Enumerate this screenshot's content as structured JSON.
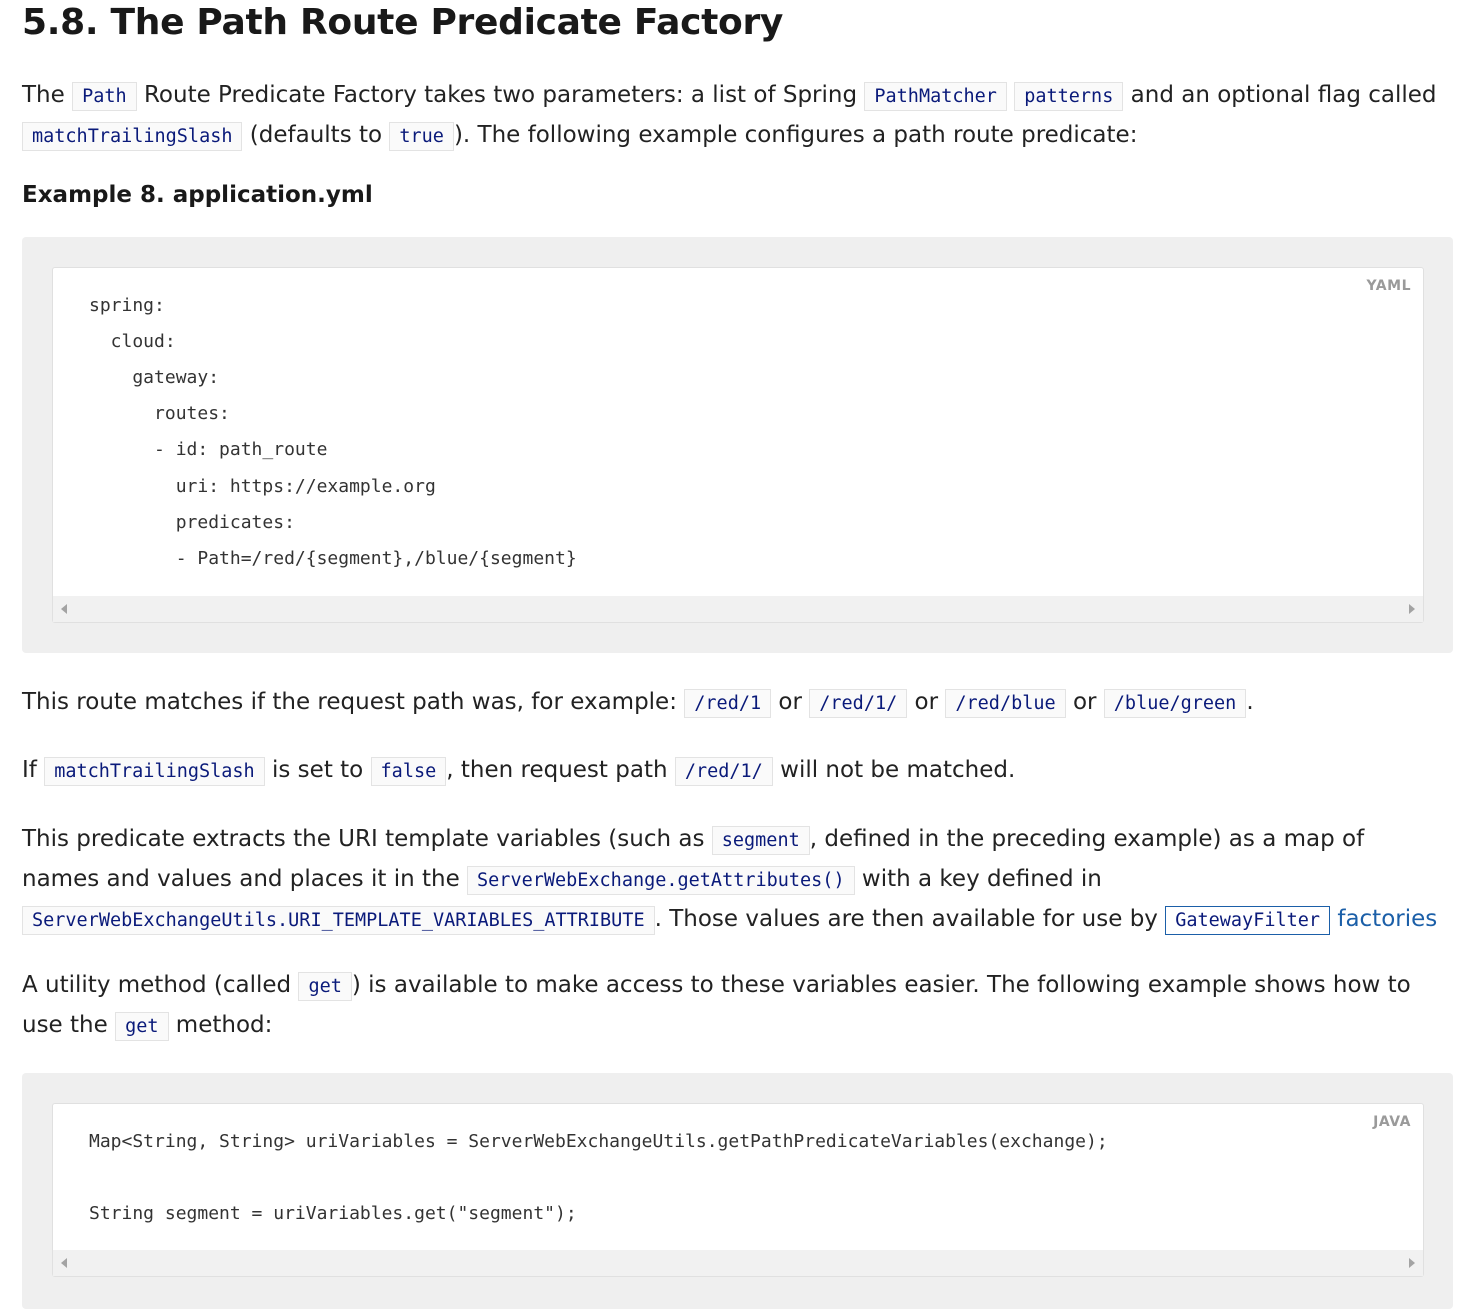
{
  "heading": "5.8. The Path Route Predicate Factory",
  "intro": {
    "t1": "The ",
    "c1": "Path",
    "t2": " Route Predicate Factory takes two parameters: a list of Spring ",
    "c2": "PathMatcher",
    "c3": "patterns",
    "t3": " and an optional flag called ",
    "c4": "matchTrailingSlash",
    "t4": " (defaults to ",
    "c5": "true",
    "t5": "). The following example configures a path route predicate:"
  },
  "example": {
    "title": "Example 8. application.yml",
    "lang": "YAML",
    "lines": [
      "spring:",
      "  cloud:",
      "    gateway:",
      "      routes:",
      "      - id: path_route",
      "        uri: https://example.org",
      "        predicates:",
      "        - Path=/red/{segment},/blue/{segment}"
    ]
  },
  "matches": {
    "t1": "This route matches if the request path was, for example: ",
    "c1": "/red/1",
    "or": " or ",
    "c2": "/red/1/",
    "c3": "/red/blue",
    "c4": "/blue/green",
    "end": "."
  },
  "trailing": {
    "t1": "If ",
    "c1": "matchTrailingSlash",
    "t2": " is set to ",
    "c2": "false",
    "t3": ", then request path ",
    "c3": "/red/1/",
    "t4": " will not be matched."
  },
  "extract": {
    "t1": "This predicate extracts the URI template variables (such as ",
    "c1": "segment",
    "t2": ", defined in the preceding example) as a map of names and values and places it in the ",
    "c2": "ServerWebExchange.getAttributes()",
    "t3": " with a key defined in ",
    "c3": "ServerWebExchangeUtils.URI_TEMPLATE_VARIABLES_ATTRIBUTE",
    "t4": ". Those values are then available for use by ",
    "link_code": "GatewayFilter",
    "link_text": "factories"
  },
  "utility": {
    "t1": "A utility method (called ",
    "c1": "get",
    "t2": ") is available to make access to these variables easier. The following example shows how to use the ",
    "c2": "get",
    "t3": " method:"
  },
  "java": {
    "lang": "JAVA",
    "line1": "Map<String, String> uriVariables = ServerWebExchangeUtils.getPathPredicateVariables(exchange);",
    "line2": "String segment = uriVariables.get(\"segment\");"
  }
}
